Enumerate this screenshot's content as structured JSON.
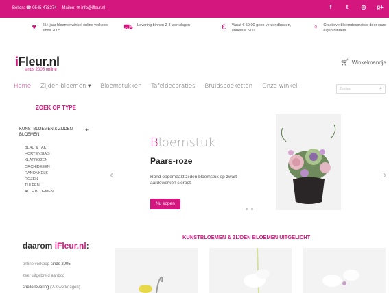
{
  "topbar": {
    "phone": "Bellen: ☎ 0545-478274",
    "mail": "Mailen: ✉ info@ifleur.nl",
    "social": [
      {
        "glyph": "f",
        "icon": "facebook-icon"
      },
      {
        "glyph": "t",
        "icon": "twitter-icon"
      },
      {
        "glyph": "◎",
        "icon": "pinterest-icon"
      },
      {
        "glyph": "g+",
        "icon": "google-plus-icon"
      }
    ]
  },
  "usps": [
    {
      "icon": "heart-icon",
      "glyph": "♥",
      "text": "25+ jaar bloemenwinkel online verkoop sinds 2005"
    },
    {
      "icon": "truck-icon",
      "glyph": "⛟",
      "text": "Levering binnen 2-3 werkdagen"
    },
    {
      "icon": "euro-icon",
      "glyph": "€",
      "text": "Vanaf € 50,00 geen verzendkosten, anders € 5,00"
    },
    {
      "icon": "lightbulb-icon",
      "glyph": "♀",
      "text": "Creatieve bloemdecoraties door onze eigen binders"
    }
  ],
  "logo": {
    "i": "i",
    "rest": "Fleur.nl",
    "tagline": "sinds 2005 online"
  },
  "cart": {
    "label": "Winkelmandje"
  },
  "nav": {
    "items": [
      "Home",
      "Zijden bloemen ▾",
      "Bloemstukken",
      "Tafeldecoraties",
      "Bruidsboeketten",
      "Onze winkel"
    ],
    "search_placeholder": "Zoeken"
  },
  "sidebar": {
    "title": "ZOEK OP TYPE",
    "category": "KUNSTBLOEMEN & ZIJDEN BLOEMEN",
    "expand": "+",
    "items": [
      "BLAD & TAK",
      "HORTENSIA'S",
      "KLAPROZEN",
      "ORCHIDEEEN",
      "RANONKELS",
      "ROZEN",
      "TULPEN",
      "ALLE BLOEMEN"
    ]
  },
  "slider": {
    "title_first": "B",
    "title_rest": "loemstuk",
    "subtitle": "Paars-roze",
    "description": "Rond opgemaakt zijden bloemstuk op zwart aardewerken sierpot.",
    "button": "Nu kopen",
    "prev": "‹",
    "next": "›"
  },
  "why": {
    "title_pre": "daarom ",
    "title_brand": "iFleur.nl",
    "title_post": ":",
    "items": [
      {
        "light": "online verkoop ",
        "bold": "sinds 2005!"
      },
      {
        "light": "zeer uitgebreid aanbod",
        "bold": ""
      },
      {
        "light": "",
        "bold": "snelle levering",
        "suffix": " (2-3 werkdagen)"
      }
    ]
  },
  "featured": {
    "title": "KUNSTBLOEMEN & ZIJDEN BLOEMEN UITGELICHT"
  },
  "colors": {
    "accent": "#d4177f"
  }
}
